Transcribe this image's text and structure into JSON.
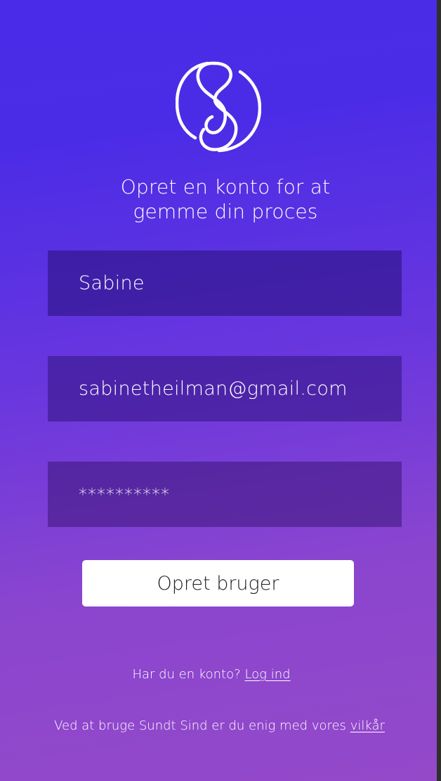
{
  "headline": {
    "line1": "Opret en konto for at",
    "line2": "gemme din proces"
  },
  "form": {
    "name_value": "Sabine",
    "email_value": "sabinetheilman@gmail.com",
    "password_value": "**********",
    "submit_label": "Opret bruger"
  },
  "login": {
    "prompt": "Har du en konto?",
    "link_label": "Log ind"
  },
  "terms": {
    "text": "Ved at bruge Sundt Sind er du enig med vores",
    "link_label": "vilkår"
  },
  "icons": {
    "logo": "sundt-sind-logo-icon"
  },
  "colors": {
    "gradient_top": "#4a2be8",
    "gradient_bottom": "#9449c9",
    "button_bg": "#ffffff",
    "text": "#ffffff"
  }
}
